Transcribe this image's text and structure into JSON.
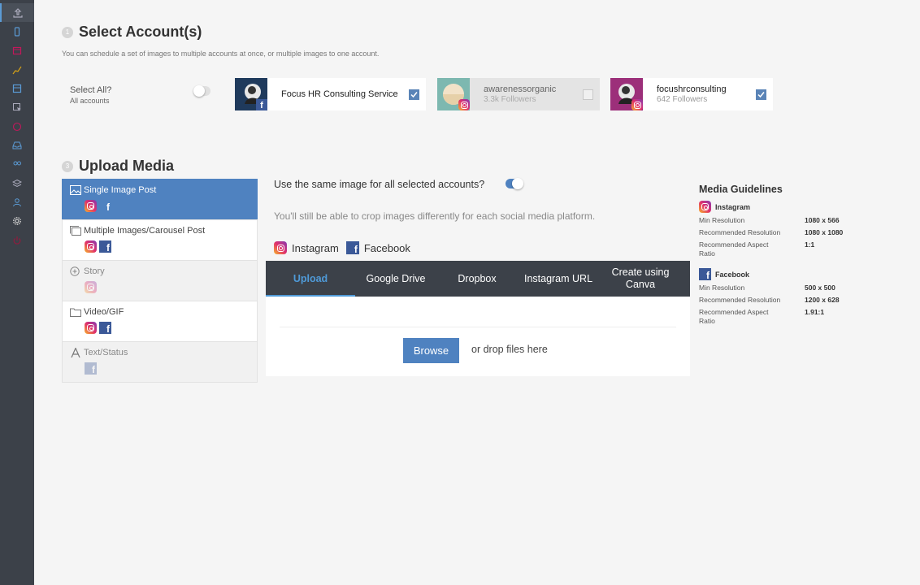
{
  "sidebar": {
    "icons": [
      "upload-icon",
      "phone-icon",
      "calendar-icon",
      "chart-icon",
      "grid-icon",
      "cursor-icon",
      "clock-icon",
      "inbox-icon",
      "users-icon",
      "layers-icon",
      "user-icon",
      "gear-icon",
      "power-icon"
    ]
  },
  "step1": {
    "num": "1",
    "title": "Select Account(s)",
    "subtitle": "You can schedule a set of images to multiple accounts at once, or multiple images to one account."
  },
  "select_all": {
    "label": "Select All?",
    "sublabel": "All accounts",
    "enabled": false
  },
  "accounts": [
    {
      "name": "Focus HR Consulting Service",
      "followers": "",
      "network": "facebook",
      "checked": true,
      "disabled": false
    },
    {
      "name": "awarenessorganic",
      "followers": "3.3k Followers",
      "network": "instagram",
      "checked": false,
      "disabled": true
    },
    {
      "name": "focushrconsulting",
      "followers": "642 Followers",
      "network": "instagram",
      "checked": true,
      "disabled": false
    }
  ],
  "step3": {
    "num": "3",
    "title": "Upload Media"
  },
  "post_types": [
    {
      "label": "Single Image Post",
      "networks": [
        "instagram",
        "facebook"
      ],
      "active": true
    },
    {
      "label": "Multiple Images/Carousel Post",
      "networks": [
        "instagram",
        "facebook"
      ]
    },
    {
      "label": "Story",
      "networks": [
        "instagram"
      ],
      "disabled": true
    },
    {
      "label": "Video/GIF",
      "networks": [
        "instagram",
        "facebook"
      ]
    },
    {
      "label": "Text/Status",
      "networks": [
        "facebook"
      ],
      "disabled": true
    }
  ],
  "same_image": {
    "question": "Use the same image for all selected accounts?",
    "enabled": true,
    "note": "You'll still be able to crop images differently for each social media platform."
  },
  "selected_networks": {
    "instagram": "Instagram",
    "facebook": "Facebook"
  },
  "upload_tabs": [
    "Upload",
    "Google Drive",
    "Dropbox",
    "Instagram URL",
    "Create using Canva"
  ],
  "browse_label": "Browse",
  "drop_text": "or drop files here",
  "guidelines": {
    "title": "Media Guidelines",
    "instagram": {
      "name": "Instagram",
      "rows": [
        {
          "k": "Min Resolution",
          "v": "1080 x 566"
        },
        {
          "k": "Recommended Resolution",
          "v": "1080 x 1080"
        },
        {
          "k": "Recommended Aspect Ratio",
          "v": "1:1"
        }
      ]
    },
    "facebook": {
      "name": "Facebook",
      "rows": [
        {
          "k": "Min Resolution",
          "v": "500 x 500"
        },
        {
          "k": "Recommended Resolution",
          "v": "1200 x 628"
        },
        {
          "k": "Recommended Aspect Ratio",
          "v": "1.91:1"
        }
      ]
    }
  },
  "colors": {
    "accent": "#4f82c0",
    "sidebar": "#3c4149",
    "facebook": "#3b5998"
  }
}
